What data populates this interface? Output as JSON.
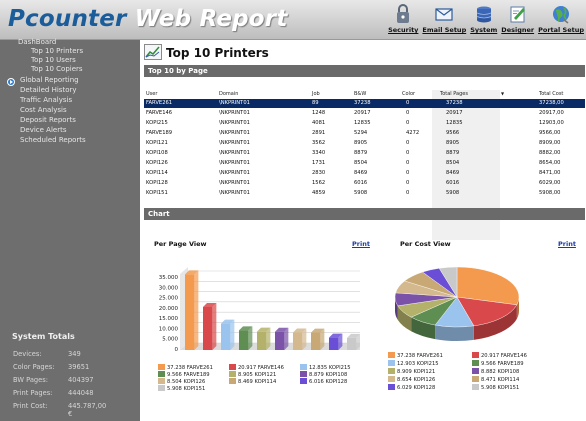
{
  "app": {
    "logo_part1": "Pcounter",
    "logo_part2": " Web Report",
    "topnav": [
      "Security",
      "Email Setup",
      "System",
      "Designer",
      "Portal Setup"
    ]
  },
  "sidebar": {
    "items": [
      {
        "label": "DashBoard",
        "level": "top"
      },
      {
        "label": "Top 10 Printers",
        "level": "sub"
      },
      {
        "label": "Top 10 Users",
        "level": "sub"
      },
      {
        "label": "Top 10 Copiers",
        "level": "sub"
      },
      {
        "label": "Global Reporting",
        "level": "top"
      },
      {
        "label": "Detailed History",
        "level": "top"
      },
      {
        "label": "Traffic Analysis",
        "level": "top"
      },
      {
        "label": "Cost Analysis",
        "level": "top"
      },
      {
        "label": "Deposit Reports",
        "level": "top"
      },
      {
        "label": "Device Alerts",
        "level": "top"
      },
      {
        "label": "Scheduled Reports",
        "level": "top"
      }
    ]
  },
  "system_totals": {
    "title": "System Totals",
    "rows": [
      {
        "label": "Devices:",
        "value": "349"
      },
      {
        "label": "Color Pages:",
        "value": "39651"
      },
      {
        "label": "BW Pages:",
        "value": "404397"
      },
      {
        "label": "Print Pages:",
        "value": "444048"
      },
      {
        "label": "Print Cost:",
        "value": "445.787,00 €"
      }
    ]
  },
  "page": {
    "title": "Top 10 Printers",
    "section_top": "Top 10 by Page",
    "section_chart": "Chart"
  },
  "table": {
    "columns": [
      "User",
      "Domain",
      "Job",
      "B&W",
      "Color",
      "Total Pages",
      "Total Cost"
    ],
    "rows": [
      [
        "FARVE261",
        "\\NKPRINT01",
        "89",
        "37238",
        "0",
        "37238",
        "37238,00"
      ],
      [
        "FARVE146",
        "\\NKPRINT01",
        "1248",
        "20917",
        "0",
        "20917",
        "20917,00"
      ],
      [
        "KOPI215",
        "\\NKPRINT01",
        "4081",
        "12835",
        "0",
        "12835",
        "12903,00"
      ],
      [
        "FARVE189",
        "\\NKPRINT01",
        "2891",
        "5294",
        "4272",
        "9566",
        "9566,00"
      ],
      [
        "KOPI121",
        "\\NKPRINT01",
        "3562",
        "8905",
        "0",
        "8905",
        "8909,00"
      ],
      [
        "KOPI108",
        "\\NKPRINT01",
        "3340",
        "8879",
        "0",
        "8879",
        "8882,00"
      ],
      [
        "KOPI126",
        "\\NKPRINT01",
        "1731",
        "8504",
        "0",
        "8504",
        "8654,00"
      ],
      [
        "KOPI114",
        "\\NKPRINT01",
        "2830",
        "8469",
        "0",
        "8469",
        "8471,00"
      ],
      [
        "KOPI128",
        "\\NKPRINT01",
        "1562",
        "6016",
        "0",
        "6016",
        "6029,00"
      ],
      [
        "KOPI151",
        "\\NKPRINT01",
        "4859",
        "5908",
        "0",
        "5908",
        "5908,00"
      ]
    ]
  },
  "charts": {
    "bar_title": "Per Page View",
    "pie_title": "Per Cost View",
    "print_label": "Print"
  },
  "chart_data": [
    {
      "type": "bar",
      "title": "Per Page View",
      "categories": [
        "FARVE261",
        "FARVE146",
        "KOPI215",
        "FARVE189",
        "KOPI121",
        "KOPI108",
        "KOPI126",
        "KOPI114",
        "KOPI128",
        "KOPI151"
      ],
      "values": [
        37238,
        20917,
        12835,
        9566,
        8905,
        8879,
        8504,
        8469,
        6016,
        5908
      ],
      "ylim": [
        0,
        35000
      ],
      "yticks": [
        "35.000",
        "30.000",
        "25.000",
        "20.000",
        "15.000",
        "10.000",
        "5.000",
        "0"
      ],
      "legend": [
        "37.238 FARVE261",
        "20.917 FARVE146",
        "12.835 KOPI215",
        "9.566 FARVE189",
        "8.905 KOPI121",
        "8.879 KOPI108",
        "8.504 KOPI126",
        "8.469 KOPI114",
        "6.016 KOPI128",
        "5.908 KOPI151"
      ],
      "colors": [
        "#f39a4f",
        "#d9484a",
        "#9ac4ee",
        "#5f8e53",
        "#b4b26a",
        "#7a52a8",
        "#d4b98e",
        "#c8a874",
        "#6a4fd6",
        "#c9c9c9"
      ]
    },
    {
      "type": "pie",
      "title": "Per Cost View",
      "categories": [
        "FARVE261",
        "FARVE146",
        "KOPI215",
        "FARVE189",
        "KOPI121",
        "KOPI108",
        "KOPI126",
        "KOPI114",
        "KOPI128",
        "KOPI151"
      ],
      "values": [
        37238,
        20917,
        12903,
        9566,
        8909,
        8882,
        8654,
        8471,
        6029,
        5908
      ],
      "legend": [
        "37.238 FARVE261",
        "20.917 FARVE146",
        "12.903 KOPI215",
        "9.566 FARVE189",
        "8.909 KOPI121",
        "8.882 KOPI108",
        "8.654 KOPI126",
        "8.471 KOPI114",
        "6.029 KOPI128",
        "5.908 KOPI151"
      ],
      "colors": [
        "#f39a4f",
        "#d9484a",
        "#9ac4ee",
        "#5f8e53",
        "#b4b26a",
        "#7a52a8",
        "#d4b98e",
        "#c8a874",
        "#6a4fd6",
        "#c9c9c9"
      ]
    }
  ]
}
